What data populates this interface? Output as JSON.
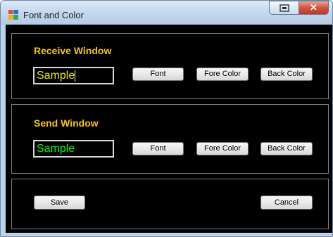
{
  "window": {
    "title": "Font and Color"
  },
  "receive": {
    "label": "Receive Window",
    "sample_text": "Sample",
    "text_color": "#e8e800",
    "font_button": "Font",
    "fore_color_button": "Fore Color",
    "back_color_button": "Back Color"
  },
  "send": {
    "label": "Send Window",
    "sample_text": "Sample",
    "text_color": "#00ff00",
    "font_button": "Font",
    "fore_color_button": "Fore Color",
    "back_color_button": "Back Color"
  },
  "actions": {
    "save_button": "Save",
    "cancel_button": "Cancel"
  },
  "colors": {
    "accent_label": "#f7c600",
    "background": "#000000"
  },
  "icons": [
    "app-icon",
    "restore-icon",
    "close-icon"
  ]
}
